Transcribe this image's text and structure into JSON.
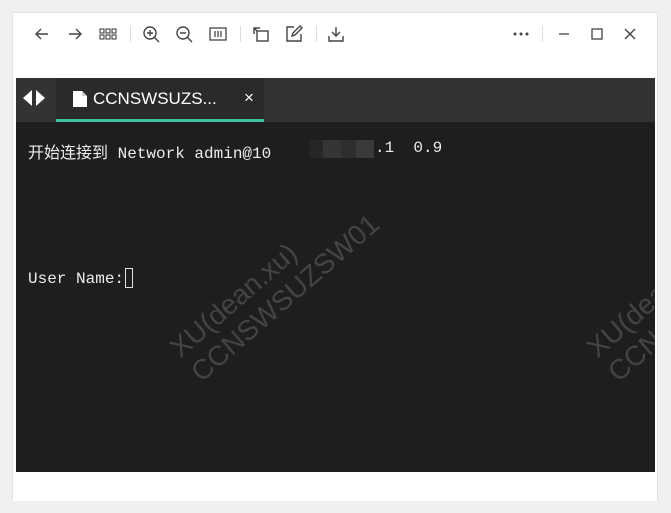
{
  "toolbar": {
    "left_icons": [
      "arrow-left-icon",
      "arrow-right-icon",
      "grid-icon",
      "zoom-in-icon",
      "zoom-out-icon",
      "fit-icon",
      "rotate-icon",
      "edit-icon",
      "download-icon"
    ],
    "right_icons": [
      "more-icon",
      "minimize-icon",
      "maximize-icon",
      "close-icon"
    ]
  },
  "tab": {
    "label": "CCNSWSUZS...",
    "close": "×"
  },
  "terminal": {
    "line1_prefix": "开始连接到 Network admin@10",
    "line1_suffix": ".1  0.9",
    "line2": "User Name:"
  },
  "watermark": {
    "line1": "XU(dean.xu)",
    "line2": "CCNSWSUZSW01"
  },
  "colors": {
    "accent": "#3ec1a1",
    "terminal_bg": "#1e1e1e",
    "tabbar_bg": "#333333"
  }
}
